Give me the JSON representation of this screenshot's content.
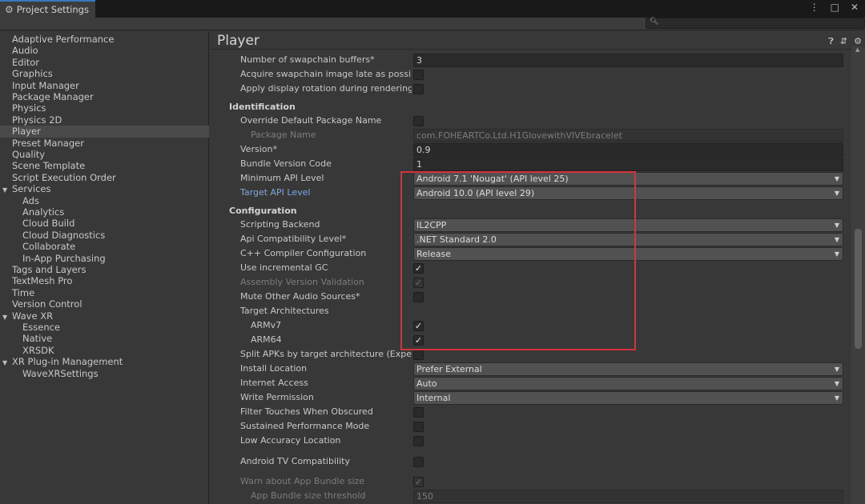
{
  "window": {
    "tab_title": "Project Settings",
    "controls": [
      "⋮",
      "□",
      "✕"
    ]
  },
  "search": {
    "placeholder": "",
    "value": ""
  },
  "sidebar": {
    "items": [
      {
        "label": "Adaptive Performance",
        "indent": 0
      },
      {
        "label": "Audio",
        "indent": 0
      },
      {
        "label": "Editor",
        "indent": 0
      },
      {
        "label": "Graphics",
        "indent": 0
      },
      {
        "label": "Input Manager",
        "indent": 0
      },
      {
        "label": "Package Manager",
        "indent": 0
      },
      {
        "label": "Physics",
        "indent": 0
      },
      {
        "label": "Physics 2D",
        "indent": 0
      },
      {
        "label": "Player",
        "indent": 0,
        "selected": true
      },
      {
        "label": "Preset Manager",
        "indent": 0
      },
      {
        "label": "Quality",
        "indent": 0
      },
      {
        "label": "Scene Template",
        "indent": 0
      },
      {
        "label": "Script Execution Order",
        "indent": 0
      },
      {
        "label": "Services",
        "indent": 0,
        "expanded": true
      },
      {
        "label": "Ads",
        "indent": 1
      },
      {
        "label": "Analytics",
        "indent": 1
      },
      {
        "label": "Cloud Build",
        "indent": 1
      },
      {
        "label": "Cloud Diagnostics",
        "indent": 1
      },
      {
        "label": "Collaborate",
        "indent": 1
      },
      {
        "label": "In-App Purchasing",
        "indent": 1
      },
      {
        "label": "Tags and Layers",
        "indent": 0
      },
      {
        "label": "TextMesh Pro",
        "indent": 0
      },
      {
        "label": "Time",
        "indent": 0
      },
      {
        "label": "Version Control",
        "indent": 0
      },
      {
        "label": "Wave XR",
        "indent": 0,
        "expanded": true
      },
      {
        "label": "Essence",
        "indent": 1
      },
      {
        "label": "Native",
        "indent": 1
      },
      {
        "label": "XRSDK",
        "indent": 1
      },
      {
        "label": "XR Plug-in Management",
        "indent": 0,
        "expanded": true
      },
      {
        "label": "WaveXRSettings",
        "indent": 1
      }
    ]
  },
  "main": {
    "title": "Player",
    "header_icons": [
      "help-icon",
      "preset-icon",
      "gear-icon"
    ],
    "rows": [
      {
        "type": "field",
        "label": "Number of swapchain buffers*",
        "value": "3"
      },
      {
        "type": "checkbox",
        "label": "Acquire swapchain image late as possible",
        "checked": false
      },
      {
        "type": "checkbox",
        "label": "Apply display rotation during rendering",
        "checked": false
      },
      {
        "type": "section",
        "label": "Identification"
      },
      {
        "type": "checkbox",
        "label": "Override Default Package Name",
        "checked": false
      },
      {
        "type": "field",
        "label": "Package Name",
        "value": "com.FOHEARTCo.Ltd.H1GlovewithVIVEbracelet",
        "disabled": true,
        "sub": true
      },
      {
        "type": "field",
        "label": "Version*",
        "value": "0.9"
      },
      {
        "type": "field",
        "label": "Bundle Version Code",
        "value": "1"
      },
      {
        "type": "dropdown",
        "label": "Minimum API Level",
        "value": "Android 7.1 'Nougat' (API level 25)"
      },
      {
        "type": "dropdown",
        "label": "Target API Level",
        "value": "Android 10.0 (API level 29)",
        "link": true
      },
      {
        "type": "section",
        "label": "Configuration"
      },
      {
        "type": "dropdown",
        "label": "Scripting Backend",
        "value": "IL2CPP"
      },
      {
        "type": "dropdown",
        "label": "Api Compatibility Level*",
        "value": ".NET Standard 2.0"
      },
      {
        "type": "dropdown",
        "label": "C++ Compiler Configuration",
        "value": "Release"
      },
      {
        "type": "checkbox",
        "label": "Use incremental GC",
        "checked": true
      },
      {
        "type": "checkbox",
        "label": "Assembly Version Validation",
        "checked": true,
        "disabled": true
      },
      {
        "type": "checkbox",
        "label": "Mute Other Audio Sources*",
        "checked": false
      },
      {
        "type": "label",
        "label": "Target Architectures"
      },
      {
        "type": "checkbox",
        "label": "ARMv7",
        "checked": true,
        "sub": true
      },
      {
        "type": "checkbox",
        "label": "ARM64",
        "checked": true,
        "sub": true
      },
      {
        "type": "checkbox",
        "label": "Split APKs by target architecture (Experim",
        "checked": false
      },
      {
        "type": "dropdown",
        "label": "Install Location",
        "value": "Prefer External"
      },
      {
        "type": "dropdown",
        "label": "Internet Access",
        "value": "Auto"
      },
      {
        "type": "dropdown",
        "label": "Write Permission",
        "value": "Internal"
      },
      {
        "type": "checkbox",
        "label": "Filter Touches When Obscured",
        "checked": false
      },
      {
        "type": "checkbox",
        "label": "Sustained Performance Mode",
        "checked": false
      },
      {
        "type": "checkbox",
        "label": "Low Accuracy Location",
        "checked": false
      },
      {
        "type": "checkbox",
        "label": "Android TV Compatibility",
        "checked": false
      },
      {
        "type": "checkbox",
        "label": "Warn about App Bundle size",
        "checked": true,
        "disabled": true
      },
      {
        "type": "field",
        "label": "App Bundle size threshold",
        "value": "150",
        "disabled": true,
        "sub": true
      }
    ]
  },
  "colors": {
    "accent": "#3a79bb",
    "highlight_box": "#d4333b",
    "link_label": "#7ea7e0"
  }
}
